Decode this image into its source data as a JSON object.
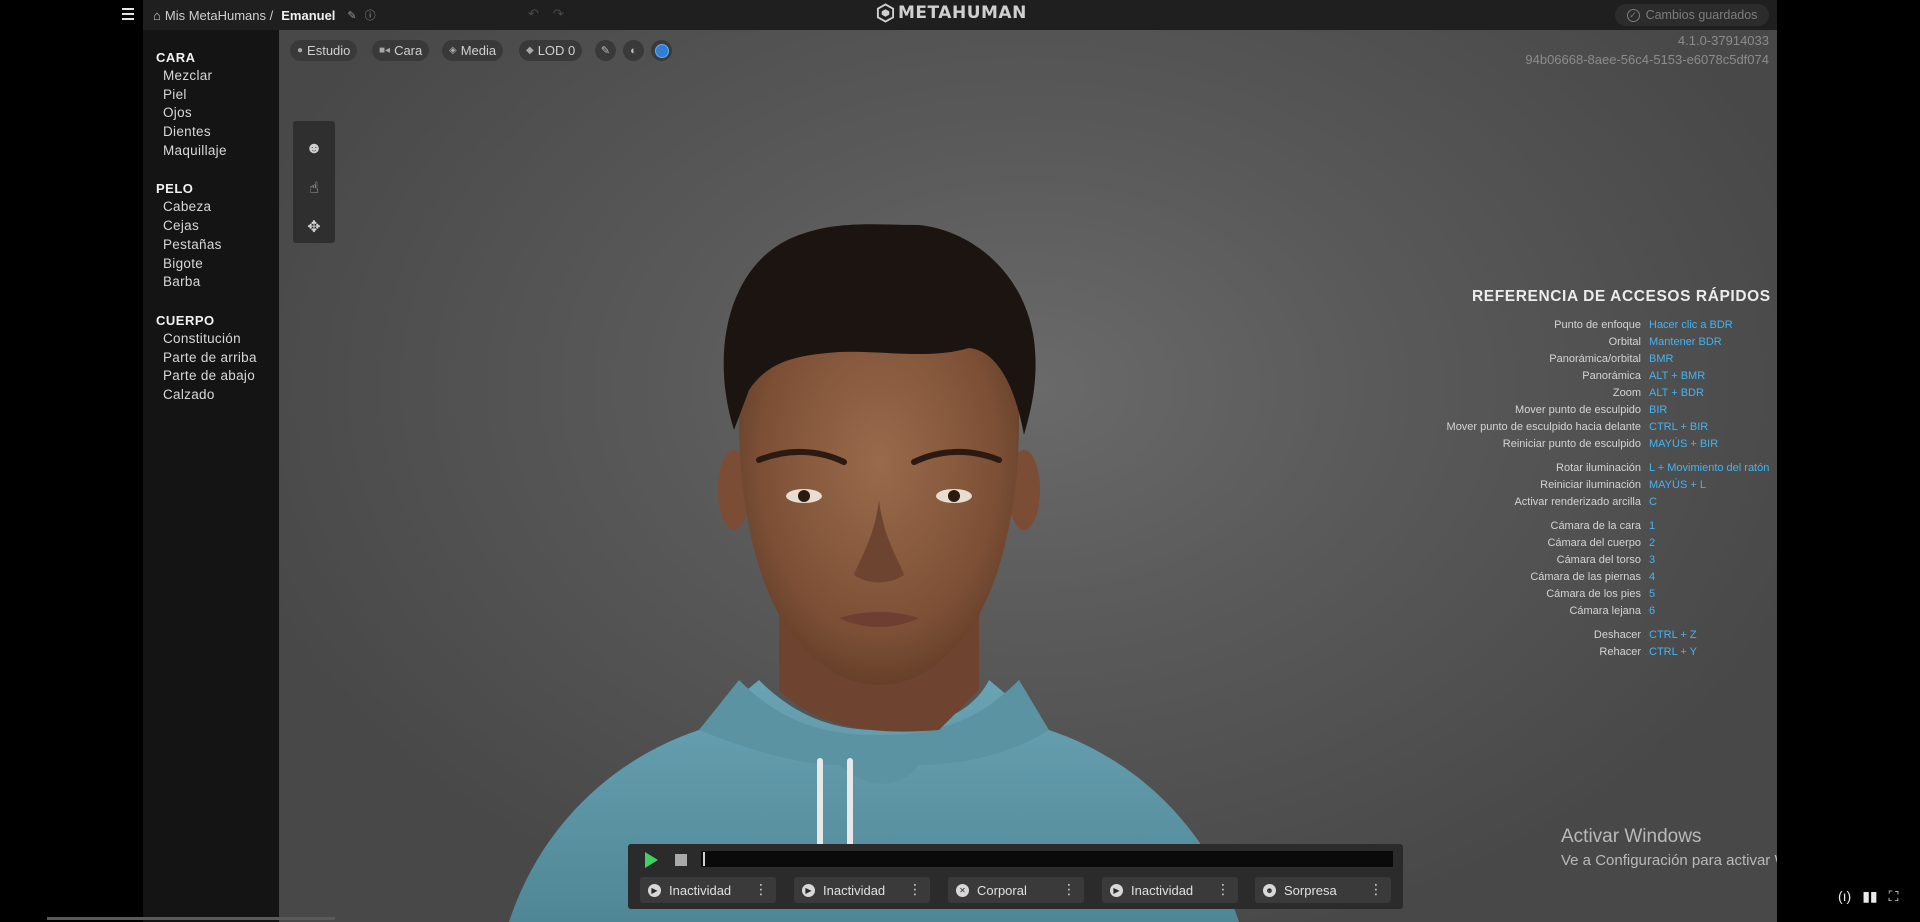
{
  "breadcrumb": {
    "home": "Mis MetaHumans /",
    "current": "Emanuel"
  },
  "brand": "METAHUMAN",
  "status": {
    "saved": "Cambios guardados"
  },
  "sidebar": {
    "sections": [
      {
        "title": "CARA",
        "items": [
          "Mezclar",
          "Piel",
          "Ojos",
          "Dientes",
          "Maquillaje"
        ]
      },
      {
        "title": "PELO",
        "items": [
          "Cabeza",
          "Cejas",
          "Pestañas",
          "Bigote",
          "Barba"
        ]
      },
      {
        "title": "CUERPO",
        "items": [
          "Constitución",
          "Parte de arriba",
          "Parte de abajo",
          "Calzado"
        ]
      }
    ]
  },
  "viewport_toolbar": {
    "lighting": "Estudio",
    "camera": "Cara",
    "quality": "Media",
    "lod": "LOD 0"
  },
  "version": {
    "build": "4.1.0-37914033",
    "id": "94b06668-8aee-56c4-5153-e6078c5df074"
  },
  "shortcuts": {
    "title": "REFERENCIA DE ACCESOS RÁPIDOS",
    "rows": [
      {
        "label": "Punto de enfoque",
        "key": "Hacer clic a BDR"
      },
      {
        "label": "Orbital",
        "key": "Mantener BDR"
      },
      {
        "label": "Panorámica/orbital",
        "key": "BMR"
      },
      {
        "label": "Panorámica",
        "key": "ALT + BMR"
      },
      {
        "label": "Zoom",
        "key": "ALT + BDR"
      },
      {
        "label": "Mover punto de esculpido",
        "key": "BIR"
      },
      {
        "label": "Mover punto de esculpido hacia delante",
        "key": "CTRL + BIR"
      },
      {
        "label": "Reiniciar punto de esculpido",
        "key": "MAYÚS + BIR"
      },
      {
        "label": "Rotar iluminación",
        "key": "L + Movimiento del ratón"
      },
      {
        "label": "Reiniciar iluminación",
        "key": "MAYÚS + L"
      },
      {
        "label": "Activar renderizado arcilla",
        "key": "C"
      },
      {
        "label": "Cámara de la cara",
        "key": "1"
      },
      {
        "label": "Cámara del cuerpo",
        "key": "2"
      },
      {
        "label": "Cámara del torso",
        "key": "3"
      },
      {
        "label": "Cámara de las piernas",
        "key": "4"
      },
      {
        "label": "Cámara de los pies",
        "key": "5"
      },
      {
        "label": "Cámara lejana",
        "key": "6"
      },
      {
        "label": "Deshacer",
        "key": "CTRL + Z"
      },
      {
        "label": "Rehacer",
        "key": "CTRL + Y"
      }
    ]
  },
  "animations": [
    {
      "label": "Inactividad",
      "icon": "play-circle-icon"
    },
    {
      "label": "Inactividad",
      "icon": "play-circle-icon"
    },
    {
      "label": "Corporal",
      "icon": "running-figure-icon"
    },
    {
      "label": "Inactividad",
      "icon": "play-circle-icon"
    },
    {
      "label": "Sorpresa",
      "icon": "face-icon"
    }
  ],
  "watermark": {
    "title": "Activar Windows",
    "subtitle": "Ve a Configuración para activar Windows."
  },
  "colors": {
    "accent_blue": "#43b4f2",
    "play_green": "#3fd166",
    "hoodie": "#5f98a8",
    "skin": "#8a5a3e"
  }
}
